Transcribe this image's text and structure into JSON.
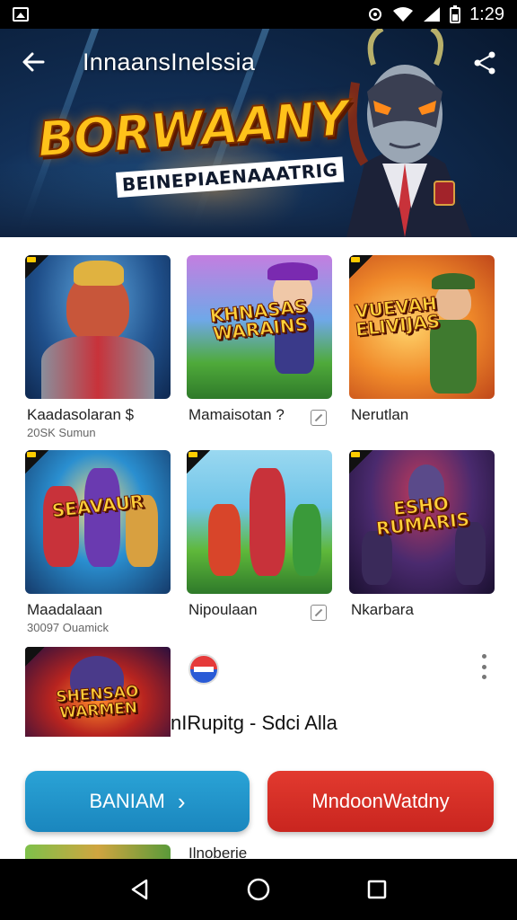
{
  "status_bar": {
    "time": "1:29"
  },
  "header": {
    "title": "InnaansInelssia",
    "banner_logo": "BORWAANY",
    "banner_subtitle": "BEINEPIAENAAATRIG"
  },
  "grid": [
    {
      "caption": "Kaadasolaran $",
      "subcaption": "20SK Sumun",
      "art_text": "",
      "edit_icon": false,
      "colors": [
        "#3a6fae",
        "#e44a2a"
      ]
    },
    {
      "caption": "Mamaisotan ?",
      "subcaption": "",
      "art_text": "KHNASAS WARAINS",
      "edit_icon": true,
      "colors": [
        "#b26bd6",
        "#4fa83a"
      ]
    },
    {
      "caption": "Nerutlan",
      "subcaption": "",
      "art_text": "VUEVAH ELIVIJAS",
      "edit_icon": false,
      "colors": [
        "#f2a33a",
        "#c0471a"
      ]
    },
    {
      "caption": "Maadalaan",
      "subcaption": "30097 Ouamick",
      "art_text": "SEAVAUR",
      "edit_icon": false,
      "colors": [
        "#2a8fd0",
        "#d63a2a"
      ]
    },
    {
      "caption": "Nipoulaan",
      "subcaption": "",
      "art_text": "",
      "edit_icon": true,
      "colors": [
        "#6ec4e8",
        "#4fa83a"
      ]
    },
    {
      "caption": "Nkarbara",
      "subcaption": "",
      "art_text": "ESHO RUMARIS",
      "edit_icon": false,
      "colors": [
        "#4a2a6e",
        "#c23a5a"
      ]
    }
  ],
  "list_item": {
    "thumb_text": "SHENSAO WARMEN",
    "title": "nIRupitg - Sdci Alla"
  },
  "buttons": {
    "primary_label": "BANIAM",
    "primary_chevron": "›",
    "secondary_label": "MndoonWatdny"
  },
  "peek_item": {
    "title": "Ilnoberie"
  },
  "colors": {
    "primary_button": "#1f93c9",
    "secondary_button": "#d62e26",
    "banner_logo": "#ffc21a"
  }
}
